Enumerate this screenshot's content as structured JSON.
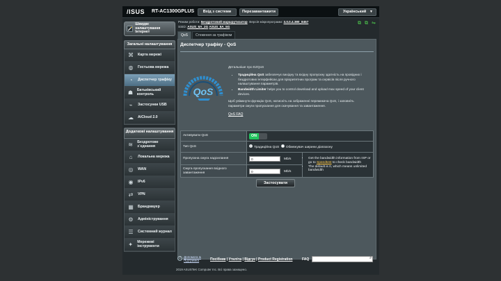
{
  "header": {
    "logo": "/ISUS",
    "model": "RT-AC1300GPLUS",
    "logout_label": "Вхід з системи",
    "reboot_label": "Перезавантажити",
    "language": "Український"
  },
  "info": {
    "mode_label": "Режим роботи:",
    "mode_value": "Бездротовий маршрутизатор",
    "firmware_label": "Версія мікропрограми:",
    "firmware_value": "3.0.0.4.380_8457",
    "ssid_label": "SSID:",
    "ssid_1": "ASUS_6A_2G",
    "ssid_2": "ASUS_6A_5G"
  },
  "sidebar": {
    "qis_label": "Швидке налаштування Інтернет",
    "general_header": "Загальні налаштування",
    "general_items": [
      {
        "label": "Карта мережі",
        "icon": "network-map-icon"
      },
      {
        "label": "Гостьова мережа",
        "icon": "guest-network-icon"
      },
      {
        "label": "Диспетчер трафіку",
        "icon": "traffic-manager-icon",
        "active": true
      },
      {
        "label": "Батьківський контроль",
        "icon": "parental-control-icon"
      },
      {
        "label": "Застосунки USB",
        "icon": "usb-icon"
      },
      {
        "label": "AiCloud 2.0",
        "icon": "cloud-icon"
      }
    ],
    "advanced_header": "Додаткові налаштування",
    "advanced_items": [
      {
        "label": "Бездротове з`єднання",
        "icon": "wireless-icon"
      },
      {
        "label": "Локальна мережа",
        "icon": "home-icon"
      },
      {
        "label": "WAN",
        "icon": "globe-icon"
      },
      {
        "label": "IPv6",
        "icon": "ipv6-icon"
      },
      {
        "label": "VPN",
        "icon": "vpn-icon"
      },
      {
        "label": "Брандмауер",
        "icon": "firewall-icon"
      },
      {
        "label": "Адміністрування",
        "icon": "admin-icon"
      },
      {
        "label": "Системний журнал",
        "icon": "log-icon"
      },
      {
        "label": "Мережеві інструменти",
        "icon": "tools-icon"
      }
    ]
  },
  "tabs": [
    "QoS",
    "Стеження за трафіком"
  ],
  "panel": {
    "title": "Диспетчер трафіку - QoS",
    "intro": "Детальніше про EZQoS",
    "bullet1_bold": "Традиційна QoS",
    "bullet1_text": "забезпечує вихідну та вхідну пропускну здатність на провідних і бездротових інтерфейсах для пріоритетних програм та сервісів після ручного налаштування параметрів.",
    "bullet2_bold": "Bandwidth Limiter",
    "bullet2_text": "helps you to control download and upload max speed of your client devices.",
    "para": "Щоб увімкнути функцію QoS, натисніть на зображенні перемикача QoS, і заповніть параметри смуги пропускання для скачування та завантаження.",
    "faq": "QoS FAQ",
    "enable_label": "Активувати QoS",
    "enable_value": "ON",
    "type_label": "Тип QoS",
    "type_opt1": "Традиційна QoS",
    "type_opt2": "Обмежувач ширини діапазону",
    "upload_label": "Пропускна смуга надсилання",
    "upload_value": "0",
    "download_label": "Смуга пропускання вхідного завантаження",
    "download_value": "0",
    "unit": "Mb/s",
    "note1_pre": "Get the bandwidth information from ISP or go to",
    "note1_link": "Speedtest",
    "note1_post": "to check bandwidth",
    "note2": "The default is 0, which means unlimited bandwidth",
    "apply_label": "Застосувати"
  },
  "footer": {
    "help": "Допомога & Підтримка",
    "links": [
      "Посібник",
      "Утиліта",
      "Відгук",
      "Product Registration"
    ],
    "faq_label": "FAQ",
    "copyright": "2019 ASUSTeK Computer Inc. Всі права захищено."
  }
}
